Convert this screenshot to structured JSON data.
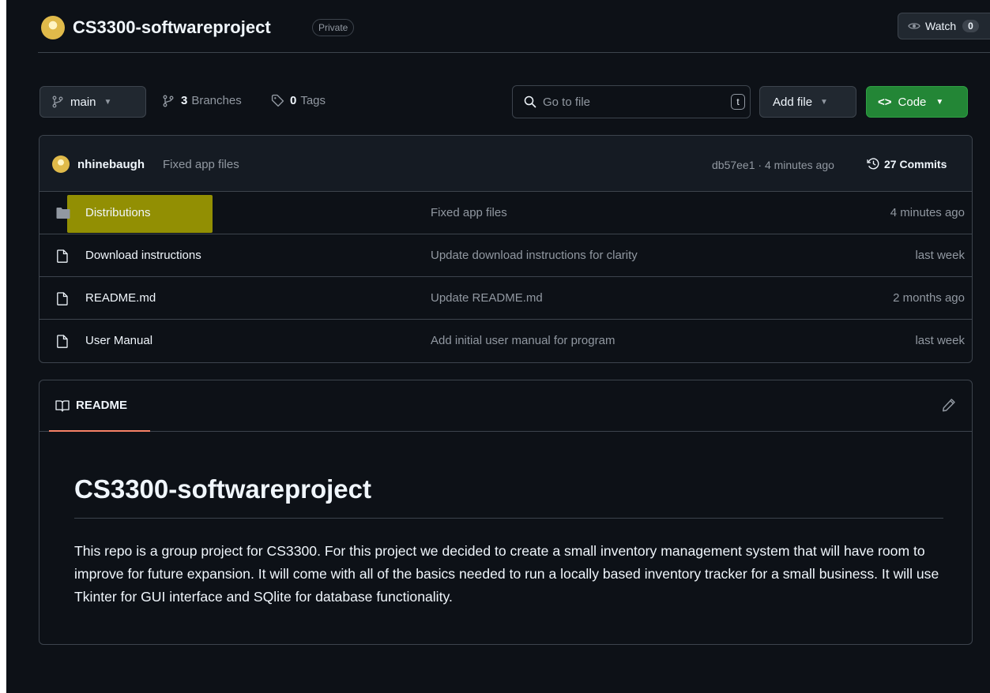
{
  "repo": {
    "name": "CS3300-softwareproject",
    "visibility": "Private",
    "watch_label": "Watch",
    "watch_count": "0"
  },
  "toolbar": {
    "branch": "main",
    "branches_count": "3",
    "branches_label": "Branches",
    "tags_count": "0",
    "tags_label": "Tags",
    "search_placeholder": "Go to file",
    "search_shortcut": "t",
    "add_file_label": "Add file",
    "code_label": "Code",
    "code_color": "#238636"
  },
  "latest_commit": {
    "author": "nhinebaugh",
    "message": "Fixed app files",
    "meta": "db57ee1 · 4 minutes ago",
    "commits_count": "27 Commits"
  },
  "files": [
    {
      "type": "folder",
      "icon": "folder-icon",
      "name": "Distributions",
      "commit": "Fixed app files",
      "time": "4 minutes ago",
      "highlighted": true
    },
    {
      "type": "file",
      "icon": "file-icon",
      "name": "Download instructions",
      "commit": "Update download instructions for clarity",
      "time": "last week"
    },
    {
      "type": "file",
      "icon": "file-icon",
      "name": "README.md",
      "commit": "Update README.md",
      "time": "2 months ago"
    },
    {
      "type": "file",
      "icon": "file-icon",
      "name": "User Manual",
      "commit": "Add initial user manual for program",
      "time": "last week"
    }
  ],
  "readme": {
    "tab_label": "README",
    "heading": "CS3300-softwareproject",
    "body": "This repo is a group project for CS3300. For this project we decided to create a small inventory management system that will have room to improve for future expansion. It will come with all of the basics needed to run a locally based inventory tracker for a small business. It will use Tkinter for GUI interface and SQlite for database functionality."
  }
}
